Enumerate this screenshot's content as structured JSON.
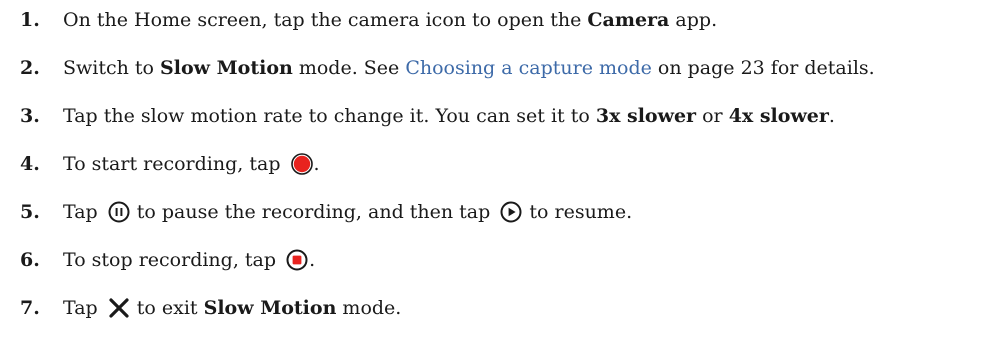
{
  "steps": [
    {
      "number": "1.",
      "text_a": "On the Home screen, tap the camera icon to open the ",
      "bold_a": "Camera",
      "text_b": " app."
    },
    {
      "number": "2.",
      "text_a": "Switch to ",
      "bold_a": "Slow Motion",
      "text_b": " mode. See ",
      "link": "Choosing a capture mode",
      "text_c": " on page 23 for details."
    },
    {
      "number": "3.",
      "text_a": "Tap the slow motion rate to change it. You can set it to ",
      "bold_a": "3x slower",
      "text_b": " or ",
      "bold_b": "4x slower",
      "text_c": "."
    },
    {
      "number": "4.",
      "text_a": "To start recording, tap ",
      "icon": "record-button-icon",
      "text_b": "."
    },
    {
      "number": "5.",
      "text_a": "Tap ",
      "icon_a": "pause-button-icon",
      "text_b": " to pause the recording, and then tap ",
      "icon_b": "play-resume-button-icon",
      "text_c": " to resume."
    },
    {
      "number": "6.",
      "text_a": "To stop recording, tap ",
      "icon": "stop-button-icon",
      "text_b": "."
    },
    {
      "number": "7.",
      "text_a": "Tap ",
      "icon": "close-x-icon",
      "text_b": " to exit ",
      "bold_a": "Slow Motion",
      "text_c": " mode."
    }
  ],
  "colors": {
    "text": "#1a1a1a",
    "link": "#3d6aa8",
    "record_red": "#e8231f",
    "icon_dark": "#1a1a1a"
  }
}
